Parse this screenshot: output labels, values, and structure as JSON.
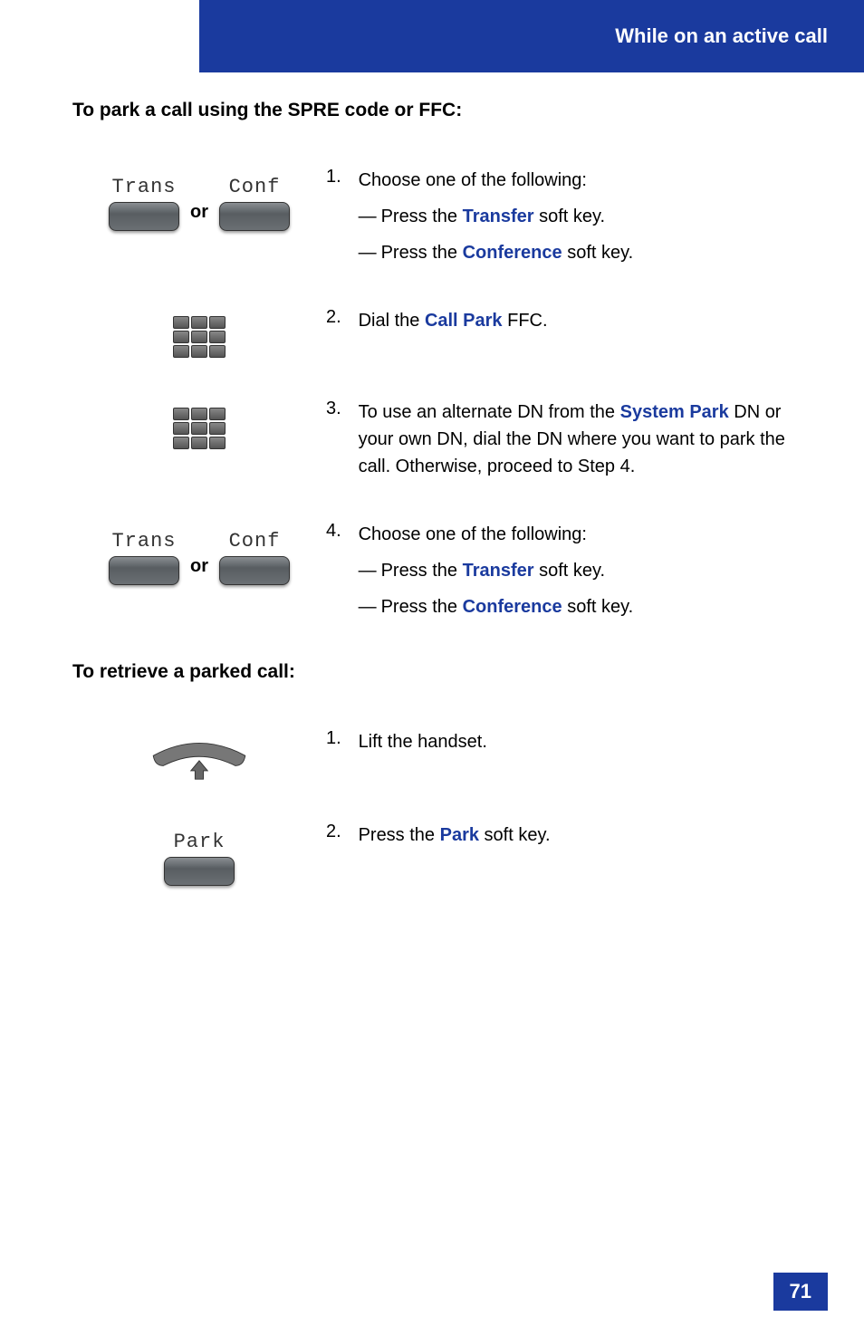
{
  "header": {
    "title": "While on an active call"
  },
  "section1": {
    "title": "To park a call using the SPRE code or FFC:",
    "icons": {
      "trans": "Trans",
      "conf": "Conf",
      "or": "or"
    },
    "steps": {
      "1": {
        "num": "1.",
        "lead": "Choose one of the following:",
        "a_pre": "Press the ",
        "a_term": "Transfer",
        "a_post": " soft key.",
        "b_pre": "Press the ",
        "b_term": "Conference",
        "b_post": " soft key."
      },
      "2": {
        "num": "2.",
        "pre": "Dial the ",
        "term": "Call Park",
        "post": " FFC."
      },
      "3": {
        "num": "3.",
        "pre": "To use an alternate DN from the ",
        "term": "System Park",
        "post": " DN or your own DN, dial the DN where you want to park the call. Otherwise, proceed to Step 4."
      },
      "4": {
        "num": "4.",
        "lead": "Choose one of the following:",
        "a_pre": "Press the ",
        "a_term": "Transfer",
        "a_post": " soft key.",
        "b_pre": "Press the ",
        "b_term": "Conference",
        "b_post": " soft key."
      }
    }
  },
  "section2": {
    "title": "To retrieve a parked call:",
    "icons": {
      "park": "Park"
    },
    "steps": {
      "1": {
        "num": "1.",
        "text": "Lift the handset."
      },
      "2": {
        "num": "2.",
        "pre": "Press the ",
        "term": "Park",
        "post": " soft key."
      }
    }
  },
  "page": "71"
}
